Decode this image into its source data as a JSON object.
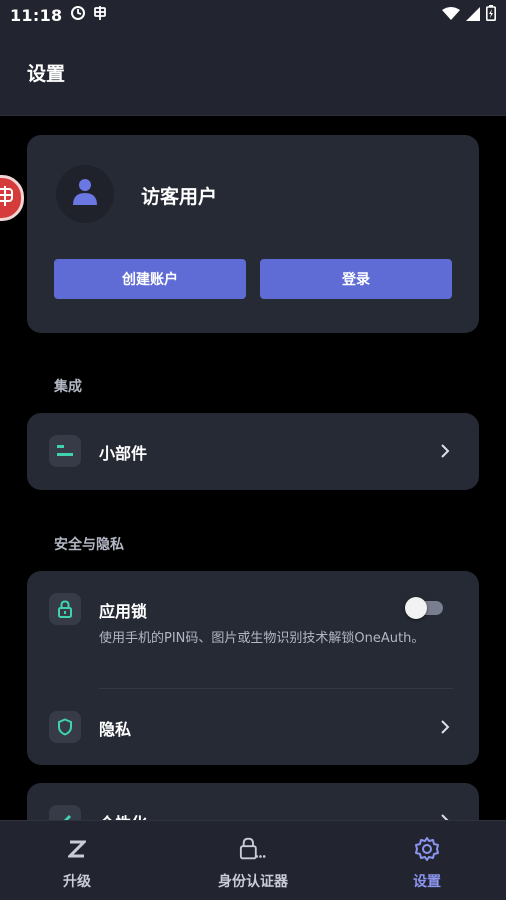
{
  "status_bar": {
    "time": "11:18"
  },
  "header": {
    "title": "设置"
  },
  "account": {
    "name": "访客用户",
    "create_label": "创建账户",
    "login_label": "登录"
  },
  "sections": {
    "integration": {
      "header": "集成",
      "widgets_label": "小部件"
    },
    "security": {
      "header": "安全与隐私",
      "app_lock_label": "应用锁",
      "app_lock_desc": "使用手机的PIN码、图片或生物识别技术解锁OneAuth。",
      "app_lock_enabled": false,
      "privacy_label": "隐私"
    },
    "personalization": {
      "label": "个性化"
    }
  },
  "bottom_nav": {
    "items": [
      {
        "label": "升级",
        "icon": "z-icon"
      },
      {
        "label": "身份认证器",
        "icon": "lock-icon"
      },
      {
        "label": "设置",
        "icon": "gear-icon",
        "active": true
      }
    ]
  },
  "colors": {
    "accent": "#5f6cd6",
    "teal": "#3fd1b0",
    "active_nav": "#8b95f0"
  }
}
